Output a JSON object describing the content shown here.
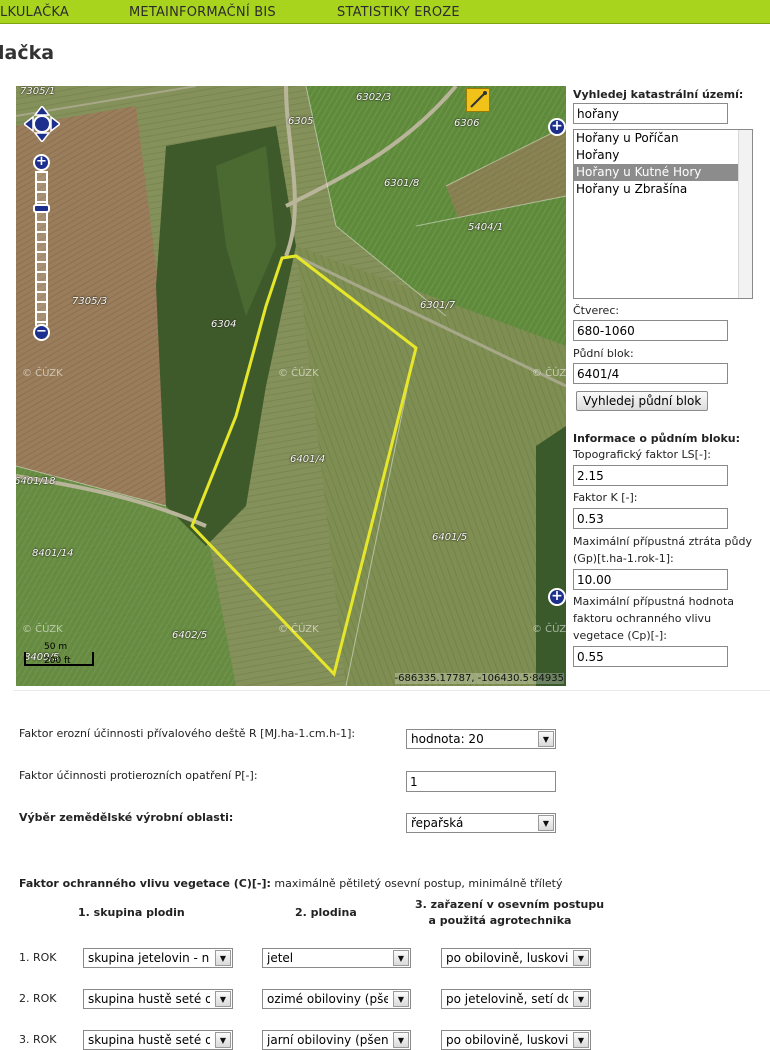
{
  "nav": {
    "items": [
      "LKULAČKA",
      "METAINFORMAČNÍ BIS",
      "STATISTIKY EROZE"
    ]
  },
  "page": {
    "title": "lačka"
  },
  "map": {
    "parcels": [
      "7305/1",
      "6302/3",
      "6305",
      "6306",
      "6301/8",
      "5404/1",
      "7305/3",
      "6304",
      "6301/7",
      "6401/4",
      "6401/18",
      "8401/14",
      "6401/5",
      "6402/5",
      "8409/5"
    ],
    "watermark": "© ČÚZK",
    "scale_top": "50 m",
    "scale_bottom": "200 ft",
    "coordinates": "-686335.17787, -106430.5·84935",
    "highlight_color": "#e6e62a"
  },
  "panel": {
    "search_label": "Vyhledej katastrální území:",
    "search_value": "hořany",
    "results": [
      {
        "label": "Hořany u Poříčan",
        "selected": false
      },
      {
        "label": "Hořany",
        "selected": false
      },
      {
        "label": "Hořany u Kutné Hory",
        "selected": true
      },
      {
        "label": "Hořany u Zbrašína",
        "selected": false
      }
    ],
    "square_label": "Čtverec:",
    "square_value": "680-1060",
    "block_label": "Půdní blok:",
    "block_value": "6401/4",
    "find_button": "Vyhledej půdní blok",
    "info_label": "Informace o půdním bloku:",
    "ls_label": "Topografický faktor LS[-]:",
    "ls_value": "2.15",
    "k_label": "Faktor K [-]:",
    "k_value": "0.53",
    "gp_label_1": "Maximální přípustná ztráta půdy",
    "gp_label_2": "(Gp)[t.ha-1.rok-1]:",
    "gp_value": "10.00",
    "cp_label_1": "Maximální přípustná hodnota",
    "cp_label_2": "faktoru ochranného vlivu",
    "cp_label_3": "vegetace (Cp)[-]:",
    "cp_value": "0.55"
  },
  "form": {
    "r_label": "Faktor erozní účinnosti přívalového deště R [MJ.ha-1.cm.h-1]:",
    "r_value": "hodnota: 20",
    "p_label": "Faktor účinnosti protierozních opatření P[-]:",
    "p_value": "1",
    "area_label": "Výběr zemědělské výrobní oblasti:",
    "area_value": "řepařská",
    "c_label_bold": "Faktor ochranného vlivu vegetace (C)[-]:",
    "c_label_rest": " maximálně pětiletý osevní postup, minimálně tříletý",
    "col1": "1. skupina plodin",
    "col2": "2. plodina",
    "col3_line1": "3. zařazení v osevním postupu",
    "col3_line2": "a použitá agrotechnika",
    "rows": [
      {
        "label": "1. ROK",
        "group": "skupina jetelovin - nej",
        "crop": "jetel",
        "placement": "po obilovině, luskovin"
      },
      {
        "label": "2. ROK",
        "group": "skupina hustě seté ol",
        "crop": "ozimé obiloviny (pšen",
        "placement": "po jetelovině, setí do"
      },
      {
        "label": "3. ROK",
        "group": "skupina hustě seté ol",
        "crop": "jarní obiloviny (pšenic",
        "placement": "po obilovině, luskovin"
      }
    ]
  }
}
